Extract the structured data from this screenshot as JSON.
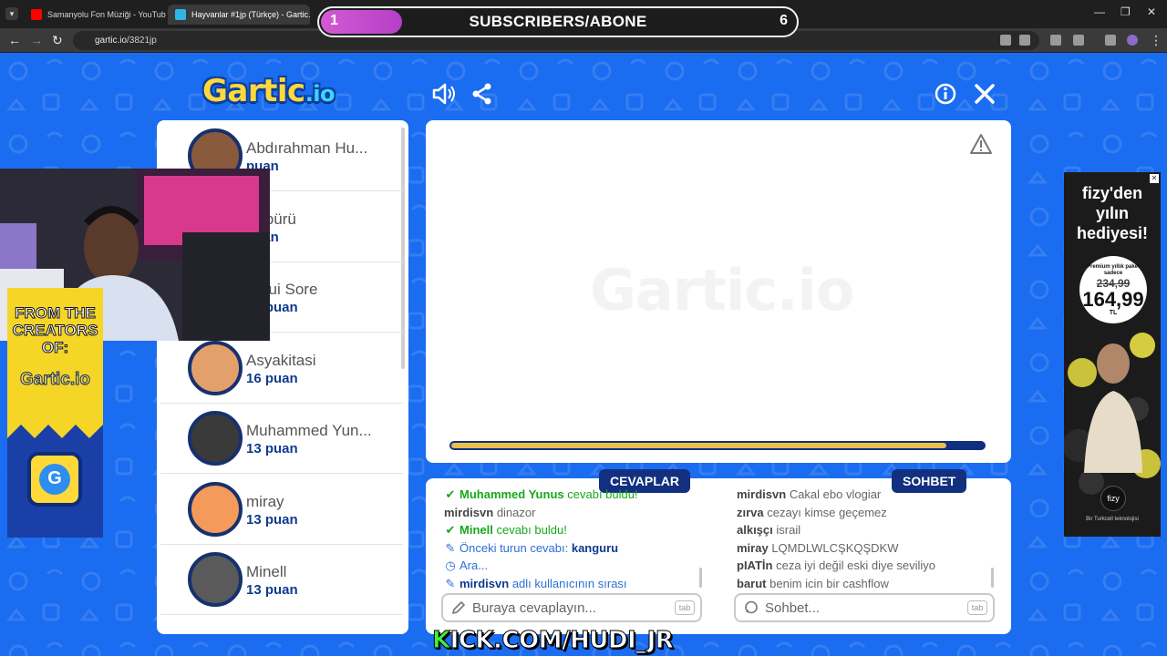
{
  "browser": {
    "tabs": [
      {
        "title": "Samanyolu Fon Müziği - YouTube",
        "active": false
      },
      {
        "title": "Hayvanlar #1jp (Türkçe) - Gartic.io",
        "active": true
      }
    ],
    "url_host": "gartic.io",
    "url_path": "/3821jp"
  },
  "subs_overlay": {
    "current": "1",
    "label": "SUBSCRIBERS/ABONE",
    "goal": "6",
    "progress_fraction": 0.17
  },
  "game": {
    "logo_main": "Gartic",
    "logo_io": ".io",
    "canvas_watermark": "Gartic.io",
    "timer_fraction": 0.93,
    "players": [
      {
        "name": "Abdırahman Hu...",
        "score": "puan"
      },
      {
        "name": "Köpürü",
        "score": "puan"
      },
      {
        "name": "Atsui Sore",
        "score": "16 puan"
      },
      {
        "name": "Asyakitasi",
        "score": "16 puan"
      },
      {
        "name": "Muhammed Yun...",
        "score": "13 puan"
      },
      {
        "name": "miray",
        "score": "13 puan"
      },
      {
        "name": "Minell",
        "score": "13 puan"
      }
    ],
    "answers_label": "CEVAPLAR",
    "chat_label": "SOHBET",
    "answers": [
      {
        "icon": "check-icon",
        "user": "Muhammed Yunus",
        "text": "cevabı buldu!",
        "style": "green"
      },
      {
        "icon": "",
        "user": "mirdisvn",
        "text": "dinazor",
        "style": "plain"
      },
      {
        "icon": "check-icon",
        "user": "Minell",
        "text": "cevabı buldu!",
        "style": "green"
      },
      {
        "icon": "pencil-icon",
        "user": "",
        "text": "Önceki turun cevabı: ",
        "strong": "kanguru",
        "style": "blue"
      },
      {
        "icon": "clock-icon",
        "user": "",
        "text": "Ara...",
        "style": "blue"
      },
      {
        "icon": "pencil-icon",
        "user": "mirdisvn",
        "text": "adlı kullanıcının sırası",
        "style": "blue"
      }
    ],
    "chat": [
      {
        "user": "mirdisvn",
        "text": "Cakal ebo vlogiar"
      },
      {
        "user": "zırva",
        "text": "cezayı kimse geçemez"
      },
      {
        "user": "alkışçı",
        "text": "israil"
      },
      {
        "user": "miray",
        "text": "LQMDLWLCŞKQŞDKW"
      },
      {
        "user": "pIATİn",
        "text": "ceza iyi değil eski diye seviliyo"
      },
      {
        "user": "barut",
        "text": "benim icin bir cashflow"
      }
    ],
    "answer_placeholder": "Buraya cevaplayın...",
    "chat_placeholder": "Sohbet...",
    "tab_key": "tab"
  },
  "ad_left": {
    "line1": "FROM THE",
    "line2": "CREATORS",
    "line3": "OF:",
    "logo": "Gartic.io",
    "app_letter": "G"
  },
  "ad_right": {
    "title": "fizy'den yılın hediyesi!",
    "price_note": "Premium yıllık paket sadece",
    "old_price": "234,99",
    "new_price": "164,99",
    "currency": "TL",
    "brand": "fizy",
    "footer": "Bir Turkcell teknolojisi"
  },
  "kick_overlay": {
    "k": "K",
    "rest": "ICK.COM/HUDI_JR"
  },
  "colors": {
    "game_bg": "#1a6cf0",
    "navy": "#12307f",
    "gold": "#e9c04e",
    "green": "#18a81a"
  }
}
